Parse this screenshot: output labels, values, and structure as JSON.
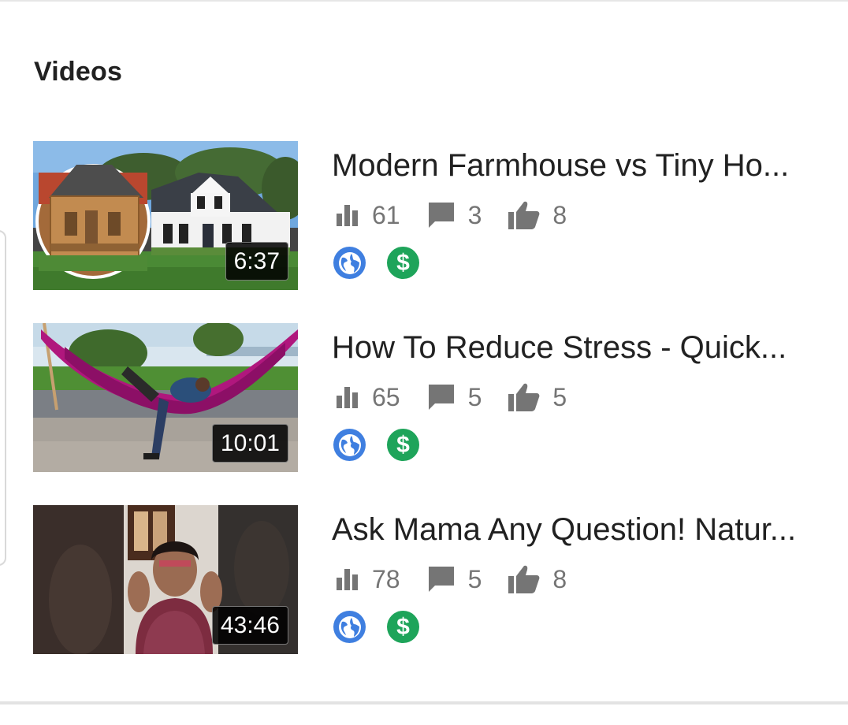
{
  "section": {
    "title": "Videos"
  },
  "colors": {
    "globe_badge": "#3f7fe0",
    "monetized_badge": "#1ea45a",
    "stat_text": "#757575"
  },
  "icons": {
    "views": "bar-chart-icon",
    "comments": "comment-icon",
    "likes": "thumbs-up-icon",
    "visibility": "globe-icon",
    "monetization": "dollar-icon"
  },
  "videos": [
    {
      "title": "Modern Farmhouse vs Tiny Ho...",
      "duration": "6:37",
      "views": "61",
      "comments": "3",
      "likes": "8",
      "money_symbol": "$"
    },
    {
      "title": "How To Reduce Stress - Quick...",
      "duration": "10:01",
      "views": "65",
      "comments": "5",
      "likes": "5",
      "money_symbol": "$"
    },
    {
      "title": "Ask Mama Any Question! Natur...",
      "duration": "43:46",
      "views": "78",
      "comments": "5",
      "likes": "8",
      "money_symbol": "$"
    }
  ]
}
